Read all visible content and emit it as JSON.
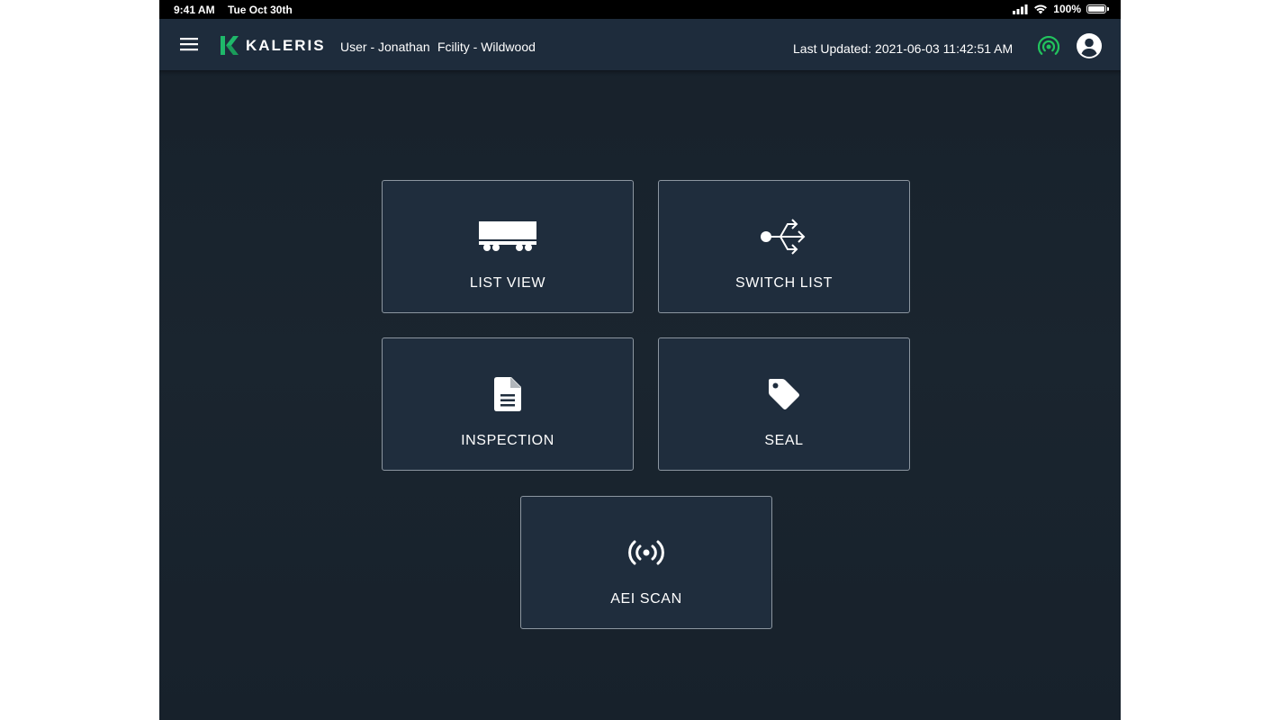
{
  "status_bar": {
    "time": "9:41 AM",
    "date": "Tue Oct 30th",
    "battery": "100%"
  },
  "header": {
    "brand": "KALERIS",
    "user": "User - Jonathan",
    "facility": "Fcility - Wildwood",
    "last_updated": "Last Updated: 2021-06-03 11:42:51 AM",
    "brand_color": "#1fb86a",
    "connection_status_color": "#22c35e"
  },
  "tiles": [
    {
      "label": "LIST VIEW",
      "icon": "railcar-icon"
    },
    {
      "label": "SWITCH LIST",
      "icon": "usb-switch-icon"
    },
    {
      "label": "INSPECTION",
      "icon": "document-icon"
    },
    {
      "label": "SEAL",
      "icon": "tag-icon"
    },
    {
      "label": "AEI SCAN",
      "icon": "radio-signal-icon"
    }
  ]
}
